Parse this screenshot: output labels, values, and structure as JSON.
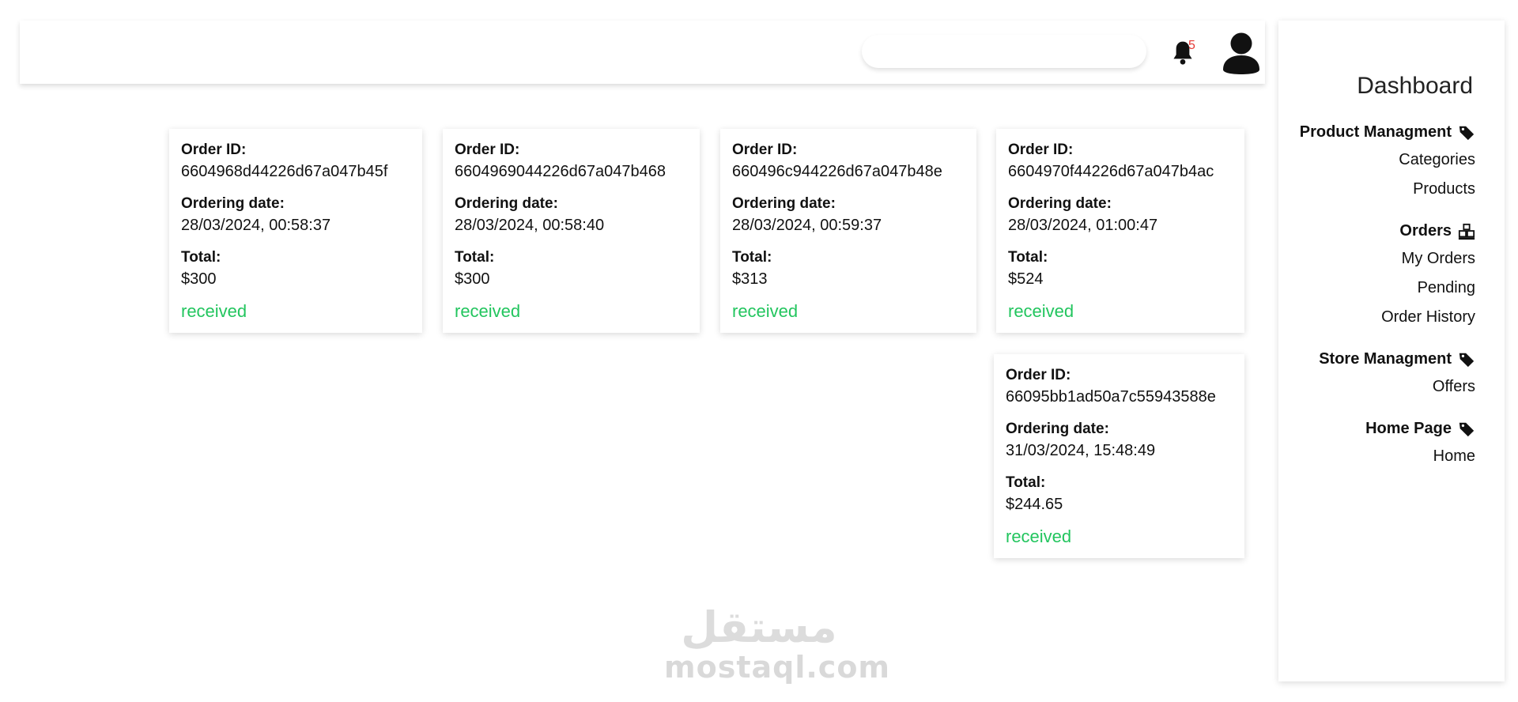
{
  "header": {
    "search": {
      "placeholder": "",
      "value": ""
    },
    "notifications": {
      "count": "5",
      "icon": "bell-icon"
    },
    "user": {
      "icon": "user-icon"
    }
  },
  "sidebar": {
    "title": "Dashboard",
    "sections": [
      {
        "heading": "Product Managment",
        "icon": "tag-icon",
        "links": [
          "Categories",
          "Products"
        ]
      },
      {
        "heading": "Orders",
        "icon": "boxes-icon",
        "links": [
          "My Orders",
          "Pending",
          "Order History"
        ]
      },
      {
        "heading": "Store Managment",
        "icon": "tag-icon",
        "links": [
          "Offers"
        ]
      },
      {
        "heading": "Home Page",
        "icon": "tag-icon",
        "links": [
          "Home"
        ]
      }
    ]
  },
  "orders": {
    "labels": {
      "id": "Order ID:",
      "date": "Ordering date:",
      "total": "Total:"
    },
    "items": [
      {
        "id": "6604968d44226d67a047b45f",
        "date": "28/03/2024, 00:58:37",
        "total": "$300",
        "status": "received"
      },
      {
        "id": "6604969044226d67a047b468",
        "date": "28/03/2024, 00:58:40",
        "total": "$300",
        "status": "received"
      },
      {
        "id": "660496c944226d67a047b48e",
        "date": "28/03/2024, 00:59:37",
        "total": "$313",
        "status": "received"
      },
      {
        "id": "6604970f44226d67a047b4ac",
        "date": "28/03/2024, 01:00:47",
        "total": "$524",
        "status": "received"
      },
      {
        "id": "66095bb1ad50a7c55943588e",
        "date": "31/03/2024, 15:48:49",
        "total": "$244.65",
        "status": "received"
      }
    ]
  },
  "colors": {
    "status_received": "#22c55e",
    "badge": "#e53935"
  },
  "watermark": {
    "text": "mostaql.com",
    "arabic": "مستقل"
  }
}
